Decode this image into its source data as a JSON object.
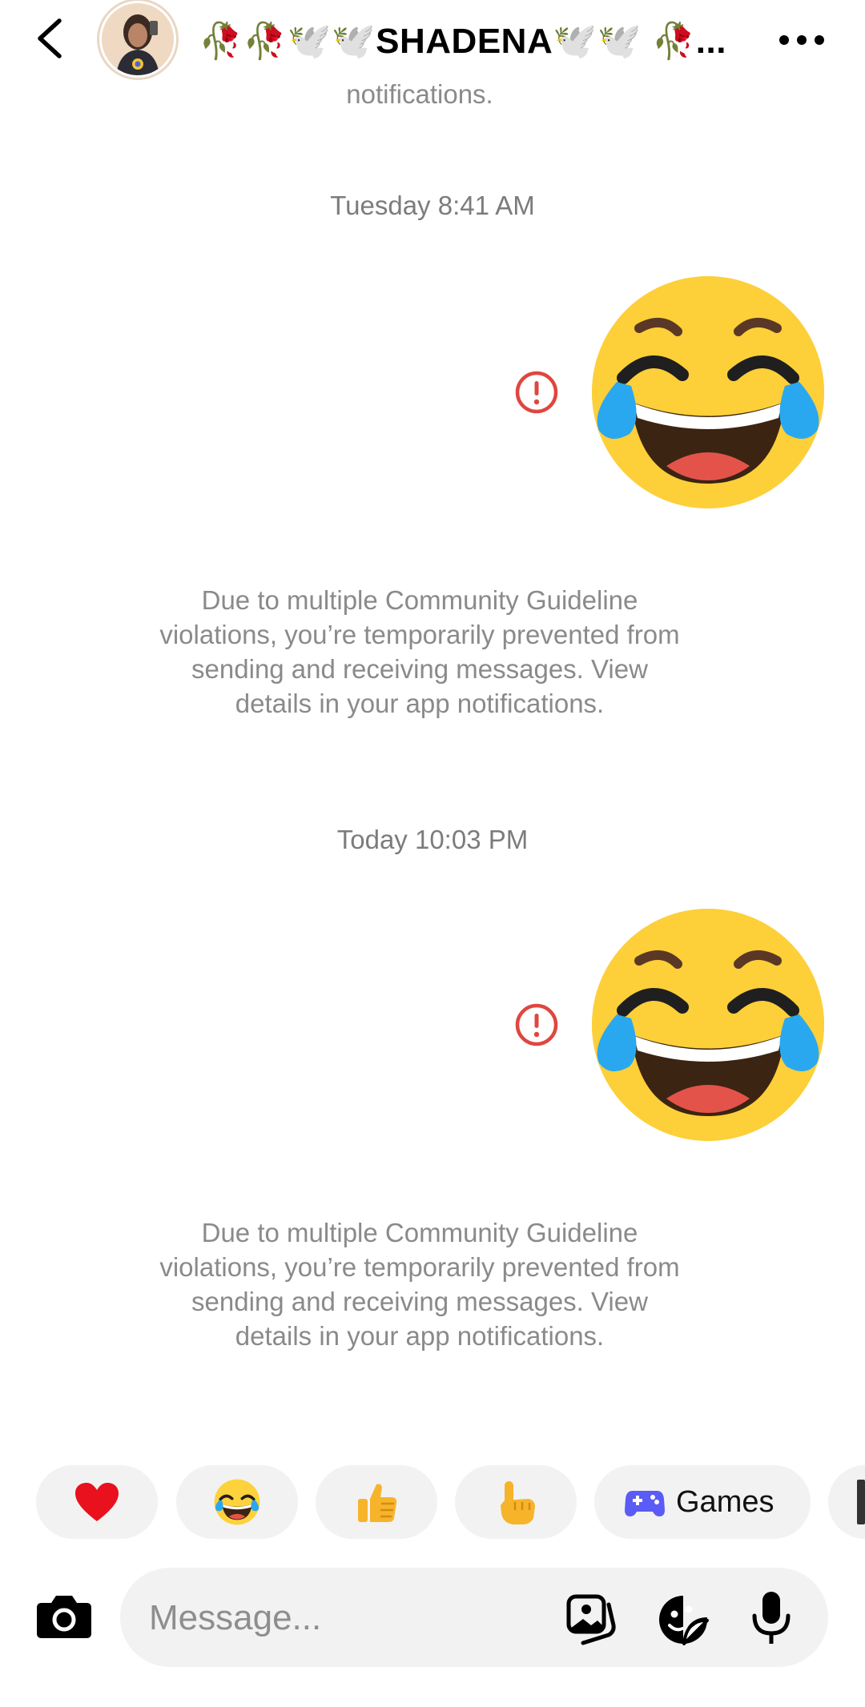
{
  "header": {
    "contact_name": "🥀🥀🕊️🕊️SHADENA🕊️🕊️ 🥀..."
  },
  "thread": {
    "clipped_notice_tail": "notifications.",
    "messages": [
      {
        "timestamp": "Tuesday 8:41 AM",
        "emoji": "😂",
        "status": "failed",
        "notice": "Due to multiple Community Guideline violations, you’re temporarily prevented from sending and receiving messages. View details in your app notifications."
      },
      {
        "timestamp": "Today 10:03 PM",
        "emoji": "😂",
        "status": "failed",
        "notice": "Due to multiple Community Guideline violations, you’re temporarily prevented from sending and receiving messages. View details in your app notifications."
      }
    ]
  },
  "quick_reactions": [
    {
      "name": "heart",
      "glyph": "❤️"
    },
    {
      "name": "laughing",
      "glyph": "😂"
    },
    {
      "name": "thumbs-up",
      "glyph": "👍"
    },
    {
      "name": "pointing",
      "glyph": "👆"
    }
  ],
  "games_chip": {
    "label": "Games",
    "icon": "gamepad-icon",
    "color": "#5b5bf6"
  },
  "composer": {
    "placeholder": "Message...",
    "icons": [
      "camera-icon",
      "gallery-icon",
      "sticker-icon",
      "microphone-icon"
    ]
  },
  "colors": {
    "error": "#e0463f",
    "notice_text": "#8a8a8a",
    "chip_bg": "#f2f2f2"
  }
}
